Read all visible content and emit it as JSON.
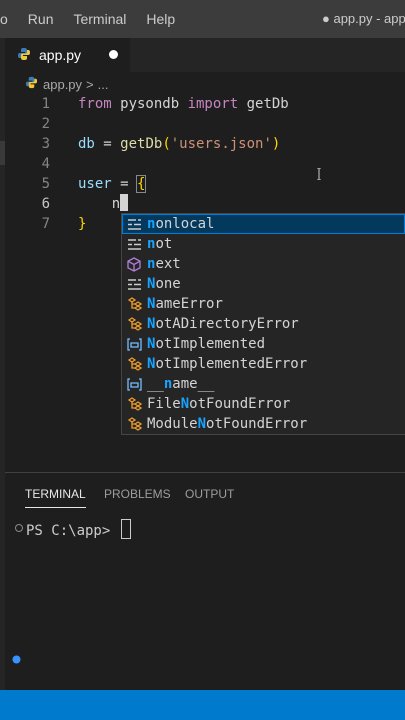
{
  "menu": [
    "o",
    "Run",
    "Terminal",
    "Help"
  ],
  "window_title": "● app.py - app",
  "tab": {
    "label": "app.py"
  },
  "breadcrumb": {
    "file": "app.py",
    "sep": ">",
    "rest": "..."
  },
  "editor": {
    "lines": [
      {
        "num": "1",
        "tokens": [
          {
            "t": "from",
            "c": "kw"
          },
          {
            "t": " pysondb ",
            "c": "plain"
          },
          {
            "t": "import",
            "c": "kw"
          },
          {
            "t": " getDb",
            "c": "plain"
          }
        ]
      },
      {
        "num": "2",
        "tokens": []
      },
      {
        "num": "3",
        "tokens": [
          {
            "t": "db",
            "c": "var"
          },
          {
            "t": " = ",
            "c": "plain"
          },
          {
            "t": "getDb",
            "c": "fn"
          },
          {
            "t": "(",
            "c": "brace"
          },
          {
            "t": "'users.json'",
            "c": "str"
          },
          {
            "t": ")",
            "c": "brace"
          }
        ]
      },
      {
        "num": "4",
        "tokens": []
      },
      {
        "num": "5",
        "tokens": [
          {
            "t": "user",
            "c": "var"
          },
          {
            "t": " = ",
            "c": "plain"
          },
          {
            "t": "{",
            "c": "brace"
          }
        ]
      },
      {
        "num": "6",
        "tokens": [
          {
            "t": "    n",
            "c": "plain"
          }
        ]
      },
      {
        "num": "7",
        "tokens": [
          {
            "t": "}",
            "c": "brace"
          }
        ]
      }
    ],
    "active_line": "6"
  },
  "suggestions": [
    {
      "icon": "keyword",
      "pre": "",
      "match": "n",
      "post": "onlocal"
    },
    {
      "icon": "keyword",
      "pre": "",
      "match": "n",
      "post": "ot"
    },
    {
      "icon": "method",
      "pre": "",
      "match": "n",
      "post": "ext"
    },
    {
      "icon": "keyword",
      "pre": "",
      "match": "N",
      "post": "one"
    },
    {
      "icon": "class",
      "pre": "",
      "match": "N",
      "post": "ameError"
    },
    {
      "icon": "class",
      "pre": "",
      "match": "N",
      "post": "otADirectoryError"
    },
    {
      "icon": "variable",
      "pre": "",
      "match": "N",
      "post": "otImplemented"
    },
    {
      "icon": "class",
      "pre": "",
      "match": "N",
      "post": "otImplementedError"
    },
    {
      "icon": "variable",
      "pre": "__",
      "match": "n",
      "post": "ame__"
    },
    {
      "icon": "class",
      "pre": "File",
      "match": "N",
      "post": "otFoundError"
    },
    {
      "icon": "class",
      "pre": "Module",
      "match": "N",
      "post": "otFoundError"
    }
  ],
  "panel": {
    "tabs": [
      "TERMINAL",
      "PROBLEMS",
      "OUTPUT"
    ],
    "active_tab": "TERMINAL",
    "terminal_prompt": "PS C:\\app> "
  },
  "colors": {
    "accent": "#007acc",
    "match": "#18a3ff",
    "selection": "#04395e",
    "keyword": "#c586c0",
    "class_icon": "#ee9d28",
    "method_icon": "#b180d7",
    "variable_icon": "#75beff"
  }
}
